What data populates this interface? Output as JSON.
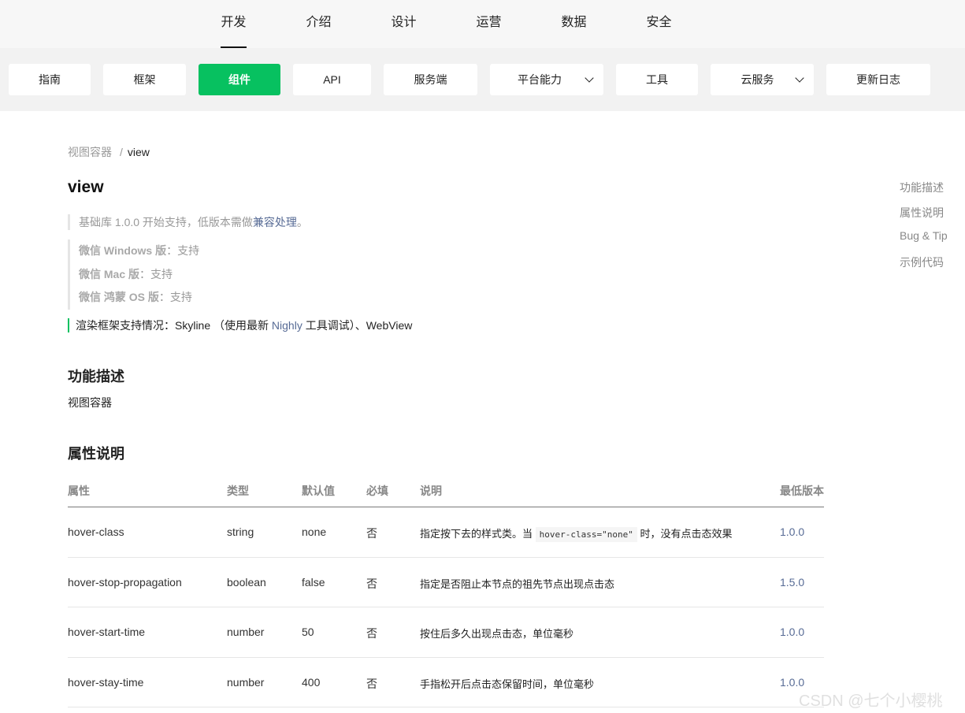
{
  "top_nav": {
    "tabs": [
      {
        "label": "开发",
        "active": true
      },
      {
        "label": "介绍"
      },
      {
        "label": "设计"
      },
      {
        "label": "运营"
      },
      {
        "label": "数据"
      },
      {
        "label": "安全"
      }
    ]
  },
  "sub_nav": {
    "items": [
      {
        "label": "指南"
      },
      {
        "label": "框架"
      },
      {
        "label": "组件",
        "active": true
      },
      {
        "label": "API"
      },
      {
        "label": "服务端"
      },
      {
        "label": "平台能力",
        "dropdown": true
      },
      {
        "label": "工具"
      },
      {
        "label": "云服务",
        "dropdown": true
      },
      {
        "label": "更新日志"
      }
    ],
    "active_color": "#07c160"
  },
  "breadcrumb": {
    "parent": "视图容器",
    "separator": "/",
    "current": "view"
  },
  "page_title": "view",
  "support_note": {
    "prefix": "基础库 1.0.0 开始支持，低版本需做",
    "link": "兼容处理",
    "suffix": "。"
  },
  "platforms": [
    {
      "name": "微信 Windows 版",
      "status": "：支持"
    },
    {
      "name": "微信 Mac 版",
      "status": "：支持"
    },
    {
      "name": "微信 鸿蒙 OS 版",
      "status": "：支持"
    }
  ],
  "render_frameworks": {
    "prefix": "渲染框架支持情况：Skyline （使用最新 ",
    "link": "Nighly",
    "suffix": " 工具调试）、WebView"
  },
  "section_function": {
    "title": "功能描述",
    "text": "视图容器"
  },
  "section_props": {
    "title": "属性说明"
  },
  "props_table": {
    "headers": [
      "属性",
      "类型",
      "默认值",
      "必填",
      "说明",
      "最低版本"
    ],
    "rows": [
      {
        "name": "hover-class",
        "type": "string",
        "default": "none",
        "required": "否",
        "desc_pre": "指定按下去的样式类。当 ",
        "desc_code": "hover-class=\"none\"",
        "desc_post": " 时，没有点击态效果",
        "version": "1.0.0"
      },
      {
        "name": "hover-stop-propagation",
        "type": "boolean",
        "default": "false",
        "required": "否",
        "desc_pre": "指定是否阻止本节点的祖先节点出现点击态",
        "desc_code": "",
        "desc_post": "",
        "version": "1.5.0"
      },
      {
        "name": "hover-start-time",
        "type": "number",
        "default": "50",
        "required": "否",
        "desc_pre": "按住后多久出现点击态，单位毫秒",
        "desc_code": "",
        "desc_post": "",
        "version": "1.0.0"
      },
      {
        "name": "hover-stay-time",
        "type": "number",
        "default": "400",
        "required": "否",
        "desc_pre": "手指松开后点击态保留时间，单位毫秒",
        "desc_code": "",
        "desc_post": "",
        "version": "1.0.0"
      }
    ]
  },
  "toc": [
    "功能描述",
    "属性说明",
    "Bug & Tip",
    "示例代码"
  ],
  "watermark": "CSDN @七个小樱桃"
}
